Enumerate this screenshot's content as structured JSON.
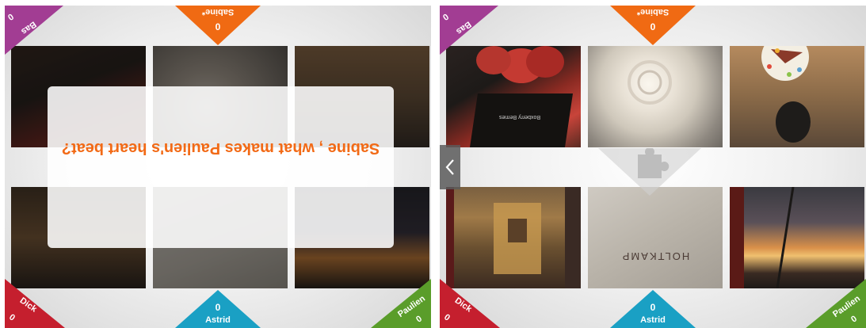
{
  "screens": [
    {
      "players": {
        "top": {
          "name": "Sabine*",
          "score": "0"
        },
        "top_left": {
          "name": "Bas",
          "score": "0"
        },
        "bottom_left": {
          "name": "Dick",
          "score": "0"
        },
        "bottom": {
          "name": "Astrid",
          "score": "0"
        },
        "bottom_right": {
          "name": "Paulien",
          "score": "0"
        }
      },
      "question": "Sabine , what makes Paulien's heart beat?",
      "tiles": [
        {
          "label": "strawberries-photo"
        },
        {
          "label": "rose-photo"
        },
        {
          "label": "cake-teapot-photo"
        },
        {
          "label": "clock-tower-photo"
        },
        {
          "label": "shopping-bag-photo"
        },
        {
          "label": "sunset-window-photo"
        }
      ]
    },
    {
      "players": {
        "top": {
          "name": "Sabine*",
          "score": "0"
        },
        "top_left": {
          "name": "Bas",
          "score": "0"
        },
        "bottom_left": {
          "name": "Dick",
          "score": "0"
        },
        "bottom": {
          "name": "Astrid",
          "score": "0"
        },
        "bottom_right": {
          "name": "Paulien",
          "score": "0"
        }
      },
      "card_text": {
        "box": "Boxberry Berries",
        "bag": "HOLTKAMP"
      },
      "tiles": [
        {
          "label": "strawberries-photo"
        },
        {
          "label": "rose-photo"
        },
        {
          "label": "cake-teapot-photo"
        },
        {
          "label": "clock-tower-photo"
        },
        {
          "label": "shopping-bag-photo"
        },
        {
          "label": "sunset-window-photo"
        }
      ]
    }
  ],
  "colors": {
    "orange": "#f06a13",
    "purple": "#a23d93",
    "red": "#c51f2e",
    "blue": "#1aa0c4",
    "green": "#5a9d2a"
  },
  "icons": {
    "back": "chevron-left-icon",
    "puzzle": "puzzle-piece-icon"
  }
}
